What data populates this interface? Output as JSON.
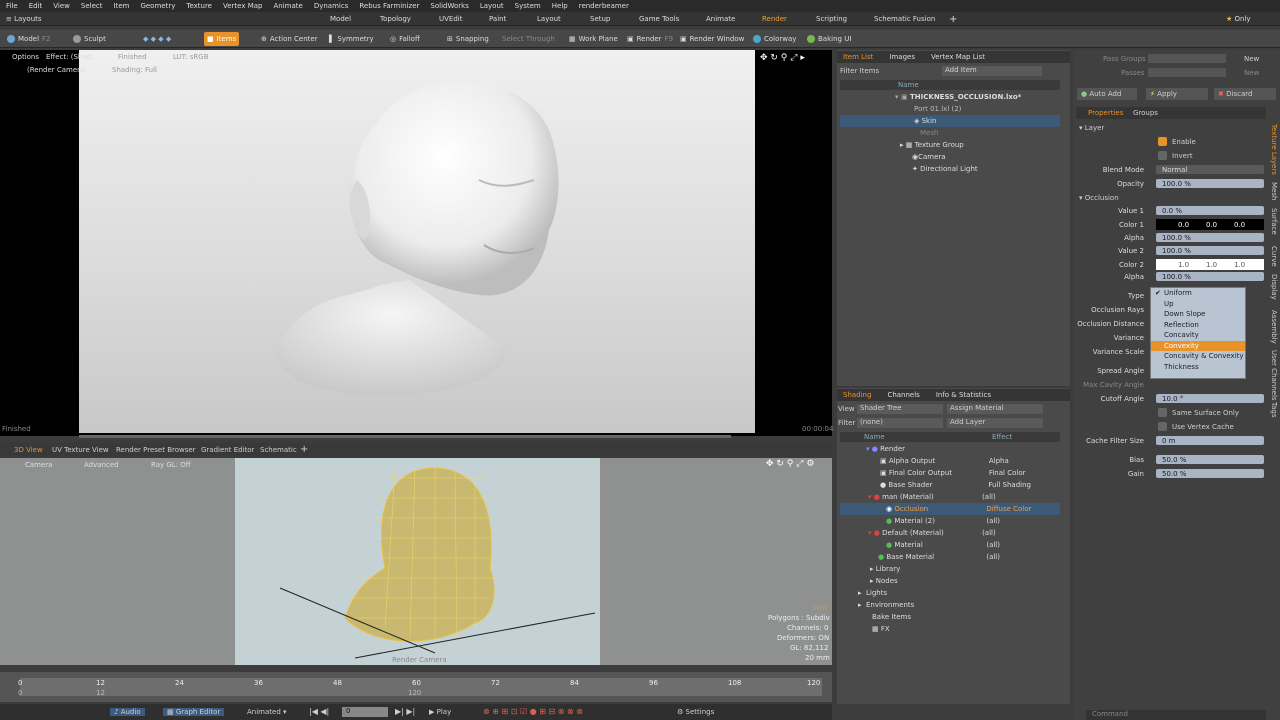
{
  "menu": [
    "File",
    "Edit",
    "View",
    "Select",
    "Item",
    "Geometry",
    "Texture",
    "Vertex Map",
    "Animate",
    "Dynamics",
    "Rebus Farminizer",
    "SolidWorks",
    "Layout",
    "System",
    "Help",
    "renderbeamer"
  ],
  "layouts_label": "Layouts",
  "layout_tabs": [
    "Model",
    "Topology",
    "UVEdit",
    "Paint",
    "Layout",
    "Setup",
    "Game Tools",
    "Animate",
    "Render",
    "Scripting",
    "Schematic Fusion"
  ],
  "active_layout": "Render",
  "only_label": "Only",
  "toolbar": {
    "model": "Model",
    "f2": "F2",
    "sculpt": "Sculpt",
    "items": "Items",
    "action_center": "Action Center",
    "symmetry": "Symmetry",
    "falloff": "Falloff",
    "snapping": "Snapping",
    "select_through": "Select Through",
    "work_plane": "Work Plane",
    "render": "Render",
    "f9": "F9",
    "render_window": "Render Window",
    "colorway": "Colorway",
    "baking_ui": "Baking UI"
  },
  "render_view": {
    "options": "Options",
    "effect": "Effect: (Shadi...",
    "render_camera": "(Render Camera)",
    "finished_tag": "Finished",
    "shading": "Shading: Full",
    "lut": "LUT: sRGB",
    "status": "Finished",
    "time": "00:00:04"
  },
  "subtabs": [
    "3D View",
    "UV Texture View",
    "Render Preset Browser",
    "Gradient Editor",
    "Schematic"
  ],
  "view3d": {
    "camera": "Camera",
    "advanced": "Advanced",
    "raygl": "Ray GL: Off",
    "info_name": "Skin",
    "polygons": "Polygons : Subdiv",
    "channels": "Channels: 0",
    "deformers": "Deformers: ON",
    "gl": "GL: 82,112",
    "size": "20 mm",
    "render_camera": "Render Camera"
  },
  "timeline": {
    "ticks": [
      "0",
      "12",
      "24",
      "36",
      "48",
      "60",
      "72",
      "84",
      "96",
      "108",
      "120"
    ],
    "sub": [
      "0",
      "12",
      "120"
    ]
  },
  "bottom": {
    "audio": "Audio",
    "graph_editor": "Graph Editor",
    "animated": "Animated",
    "frame": "0",
    "play": "Play",
    "settings": "Settings"
  },
  "item_list": {
    "tabs": [
      "Item List",
      "Images",
      "Vertex Map List"
    ],
    "filter": "Filter Items",
    "add_item": "Add Item",
    "col_name": "Name",
    "items": [
      {
        "name": "THICKNESS_OCCLUSION.lxo*"
      },
      {
        "name": "Port 01.lxl (2)"
      },
      {
        "name": "Skin"
      },
      {
        "name": "Mesh"
      },
      {
        "name": "Texture Group"
      },
      {
        "name": "Camera"
      },
      {
        "name": "Directional Light"
      }
    ]
  },
  "shading": {
    "tabs": [
      "Shading",
      "Channels",
      "Info & Statistics"
    ],
    "view_label": "View",
    "view_value": "Shader Tree",
    "assign": "Assign Material",
    "filter_label": "Filter",
    "filter_value": "(none)",
    "add_layer": "Add Layer",
    "col_name": "Name",
    "col_effect": "Effect",
    "rows": [
      {
        "name": "Render",
        "effect": ""
      },
      {
        "name": "Alpha Output",
        "effect": "Alpha"
      },
      {
        "name": "Final Color Output",
        "effect": "Final Color"
      },
      {
        "name": "Base Shader",
        "effect": "Full Shading"
      },
      {
        "name": "man (Material)",
        "effect": "(all)"
      },
      {
        "name": "Occlusion",
        "effect": "Diffuse Color"
      },
      {
        "name": "Material (2)",
        "effect": "(all)"
      },
      {
        "name": "Default (Material)",
        "effect": "(all)"
      },
      {
        "name": "Material",
        "effect": "(all)"
      },
      {
        "name": "Base Material",
        "effect": "(all)"
      },
      {
        "name": "Library",
        "effect": ""
      },
      {
        "name": "Nodes",
        "effect": ""
      },
      {
        "name": "Lights",
        "effect": ""
      },
      {
        "name": "Environments",
        "effect": ""
      },
      {
        "name": "Bake Items",
        "effect": ""
      },
      {
        "name": "FX",
        "effect": ""
      }
    ]
  },
  "props": {
    "pass_groups": "Pass Groups",
    "passes": "Passes",
    "new1": "New",
    "new2": "New",
    "auto_add": "Auto Add",
    "apply": "Apply",
    "discard": "Discard",
    "tabs": [
      "Properties",
      "Groups"
    ],
    "layer": "Layer",
    "enable": "Enable",
    "invert": "Invert",
    "blend_mode": "Blend Mode",
    "blend_value": "Normal",
    "opacity": "Opacity",
    "opacity_value": "100.0 %",
    "occlusion": "Occlusion",
    "value1": "Value 1",
    "value1_v": "0.0 %",
    "color1": "Color 1",
    "color1_v": [
      "0.0",
      "0.0",
      "0.0"
    ],
    "alpha1": "Alpha",
    "alpha1_v": "100.0 %",
    "value2": "Value 2",
    "value2_v": "100.0 %",
    "color2": "Color 2",
    "color2_v": [
      "1.0",
      "1.0",
      "1.0"
    ],
    "alpha2": "Alpha",
    "alpha2_v": "100.0 %",
    "type": "Type",
    "occ_rays": "Occlusion Rays",
    "occ_dist": "Occlusion Distance",
    "variance": "Variance",
    "variance_scale": "Variance Scale",
    "spread": "Spread Angle",
    "max_cav": "Max Cavity Angle",
    "cutoff": "Cutoff Angle",
    "cutoff_v": "10.0 °",
    "same_surface": "Same Surface Only",
    "vertex_cache": "Use Vertex Cache",
    "cache_filter": "Cache Filter Size",
    "cache_filter_v": "0 m",
    "bias": "Bias",
    "bias_v": "50.0 %",
    "gain": "Gain",
    "gain_v": "50.0 %",
    "command": "Command",
    "type_options": [
      "Uniform",
      "Up",
      "Down Slope",
      "Reflection",
      "Concavity",
      "Convexity",
      "Concavity & Convexity",
      "Thickness"
    ],
    "type_selected": "Convexity",
    "side_tabs": [
      "Texture Layers",
      "Mesh",
      "Surface",
      "Curve",
      "Display",
      "Assembly",
      "User Channels",
      "Tags"
    ]
  }
}
